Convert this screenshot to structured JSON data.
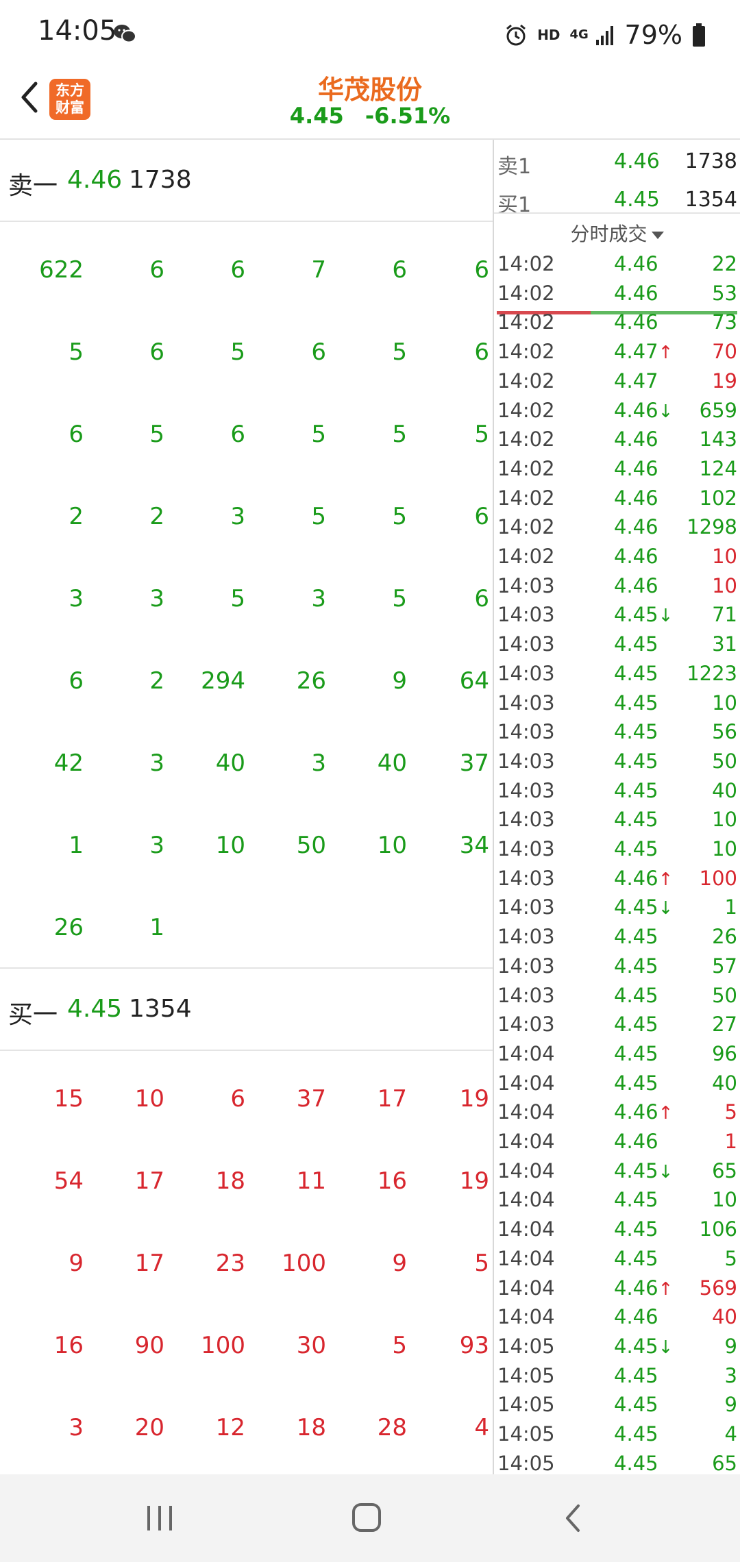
{
  "status": {
    "time": "14:05",
    "battery": "79%",
    "hd": "HD",
    "network": "4G",
    "icons": [
      "wechat-icon",
      "alarm-icon",
      "signal-icon",
      "battery-icon"
    ]
  },
  "header": {
    "logo_line1": "东方",
    "logo_line2": "财富",
    "title": "华茂股份",
    "price": "4.45",
    "change": "-6.51%"
  },
  "sell_one": {
    "label": "卖一",
    "price": "4.46",
    "volume": "1738"
  },
  "sell_queue": [
    [
      "622",
      "6",
      "6",
      "7",
      "6",
      "6"
    ],
    [
      "5",
      "6",
      "5",
      "6",
      "5",
      "6"
    ],
    [
      "6",
      "5",
      "6",
      "5",
      "5",
      "5"
    ],
    [
      "2",
      "2",
      "3",
      "5",
      "5",
      "6"
    ],
    [
      "3",
      "3",
      "5",
      "3",
      "5",
      "6"
    ],
    [
      "6",
      "2",
      "294",
      "26",
      "9",
      "64"
    ],
    [
      "42",
      "3",
      "40",
      "3",
      "40",
      "37"
    ],
    [
      "1",
      "3",
      "10",
      "50",
      "10",
      "34"
    ],
    [
      "26",
      "1"
    ]
  ],
  "buy_one": {
    "label": "买一",
    "price": "4.45",
    "volume": "1354"
  },
  "buy_queue": [
    [
      "15",
      "10",
      "6",
      "37",
      "17",
      "19"
    ],
    [
      "54",
      "17",
      "18",
      "11",
      "16",
      "19"
    ],
    [
      "9",
      "17",
      "23",
      "100",
      "9",
      "5"
    ],
    [
      "16",
      "90",
      "100",
      "30",
      "5",
      "93"
    ],
    [
      "3",
      "20",
      "12",
      "18",
      "28",
      "4"
    ]
  ],
  "quote": {
    "sell1": {
      "label": "卖1",
      "price": "4.46",
      "volume": "1738"
    },
    "buy1": {
      "label": "买1",
      "price": "4.45",
      "volume": "1354"
    }
  },
  "ticks_header": "分时成交",
  "ticks": [
    {
      "time": "14:02",
      "price": "4.46",
      "arrow": "",
      "vol": "22",
      "dir": "green"
    },
    {
      "time": "14:02",
      "price": "4.46",
      "arrow": "",
      "vol": "53",
      "dir": "green"
    },
    {
      "time": "14:02",
      "price": "4.46",
      "arrow": "",
      "vol": "73",
      "dir": "green"
    },
    {
      "time": "14:02",
      "price": "4.47",
      "arrow": "↑",
      "vol": "70",
      "dir": "red"
    },
    {
      "time": "14:02",
      "price": "4.47",
      "arrow": "",
      "vol": "19",
      "dir": "red"
    },
    {
      "time": "14:02",
      "price": "4.46",
      "arrow": "↓",
      "vol": "659",
      "dir": "green"
    },
    {
      "time": "14:02",
      "price": "4.46",
      "arrow": "",
      "vol": "143",
      "dir": "green"
    },
    {
      "time": "14:02",
      "price": "4.46",
      "arrow": "",
      "vol": "124",
      "dir": "green"
    },
    {
      "time": "14:02",
      "price": "4.46",
      "arrow": "",
      "vol": "102",
      "dir": "green"
    },
    {
      "time": "14:02",
      "price": "4.46",
      "arrow": "",
      "vol": "1298",
      "dir": "green"
    },
    {
      "time": "14:02",
      "price": "4.46",
      "arrow": "",
      "vol": "10",
      "dir": "red"
    },
    {
      "time": "14:03",
      "price": "4.46",
      "arrow": "",
      "vol": "10",
      "dir": "red"
    },
    {
      "time": "14:03",
      "price": "4.45",
      "arrow": "↓",
      "vol": "71",
      "dir": "green"
    },
    {
      "time": "14:03",
      "price": "4.45",
      "arrow": "",
      "vol": "31",
      "dir": "green"
    },
    {
      "time": "14:03",
      "price": "4.45",
      "arrow": "",
      "vol": "1223",
      "dir": "green"
    },
    {
      "time": "14:03",
      "price": "4.45",
      "arrow": "",
      "vol": "10",
      "dir": "green"
    },
    {
      "time": "14:03",
      "price": "4.45",
      "arrow": "",
      "vol": "56",
      "dir": "green"
    },
    {
      "time": "14:03",
      "price": "4.45",
      "arrow": "",
      "vol": "50",
      "dir": "green"
    },
    {
      "time": "14:03",
      "price": "4.45",
      "arrow": "",
      "vol": "40",
      "dir": "green"
    },
    {
      "time": "14:03",
      "price": "4.45",
      "arrow": "",
      "vol": "10",
      "dir": "green"
    },
    {
      "time": "14:03",
      "price": "4.45",
      "arrow": "",
      "vol": "10",
      "dir": "green"
    },
    {
      "time": "14:03",
      "price": "4.46",
      "arrow": "↑",
      "vol": "100",
      "dir": "red"
    },
    {
      "time": "14:03",
      "price": "4.45",
      "arrow": "↓",
      "vol": "1",
      "dir": "green"
    },
    {
      "time": "14:03",
      "price": "4.45",
      "arrow": "",
      "vol": "26",
      "dir": "green"
    },
    {
      "time": "14:03",
      "price": "4.45",
      "arrow": "",
      "vol": "57",
      "dir": "green"
    },
    {
      "time": "14:03",
      "price": "4.45",
      "arrow": "",
      "vol": "50",
      "dir": "green"
    },
    {
      "time": "14:03",
      "price": "4.45",
      "arrow": "",
      "vol": "27",
      "dir": "green"
    },
    {
      "time": "14:04",
      "price": "4.45",
      "arrow": "",
      "vol": "96",
      "dir": "green"
    },
    {
      "time": "14:04",
      "price": "4.45",
      "arrow": "",
      "vol": "40",
      "dir": "green"
    },
    {
      "time": "14:04",
      "price": "4.46",
      "arrow": "↑",
      "vol": "5",
      "dir": "red"
    },
    {
      "time": "14:04",
      "price": "4.46",
      "arrow": "",
      "vol": "1",
      "dir": "red"
    },
    {
      "time": "14:04",
      "price": "4.45",
      "arrow": "↓",
      "vol": "65",
      "dir": "green"
    },
    {
      "time": "14:04",
      "price": "4.45",
      "arrow": "",
      "vol": "10",
      "dir": "green"
    },
    {
      "time": "14:04",
      "price": "4.45",
      "arrow": "",
      "vol": "106",
      "dir": "green"
    },
    {
      "time": "14:04",
      "price": "4.45",
      "arrow": "",
      "vol": "5",
      "dir": "green"
    },
    {
      "time": "14:04",
      "price": "4.46",
      "arrow": "↑",
      "vol": "569",
      "dir": "red"
    },
    {
      "time": "14:04",
      "price": "4.46",
      "arrow": "",
      "vol": "40",
      "dir": "red"
    },
    {
      "time": "14:05",
      "price": "4.45",
      "arrow": "↓",
      "vol": "9",
      "dir": "green"
    },
    {
      "time": "14:05",
      "price": "4.45",
      "arrow": "",
      "vol": "3",
      "dir": "green"
    },
    {
      "time": "14:05",
      "price": "4.45",
      "arrow": "",
      "vol": "9",
      "dir": "green"
    },
    {
      "time": "14:05",
      "price": "4.45",
      "arrow": "",
      "vol": "4",
      "dir": "green"
    },
    {
      "time": "14:05",
      "price": "4.45",
      "arrow": "",
      "vol": "65",
      "dir": "green"
    }
  ],
  "colors": {
    "up": "#d8262e",
    "down": "#1a9b1a",
    "accent": "#ea6a1e"
  },
  "nav": [
    "recent-apps-icon",
    "home-icon",
    "back-icon"
  ]
}
